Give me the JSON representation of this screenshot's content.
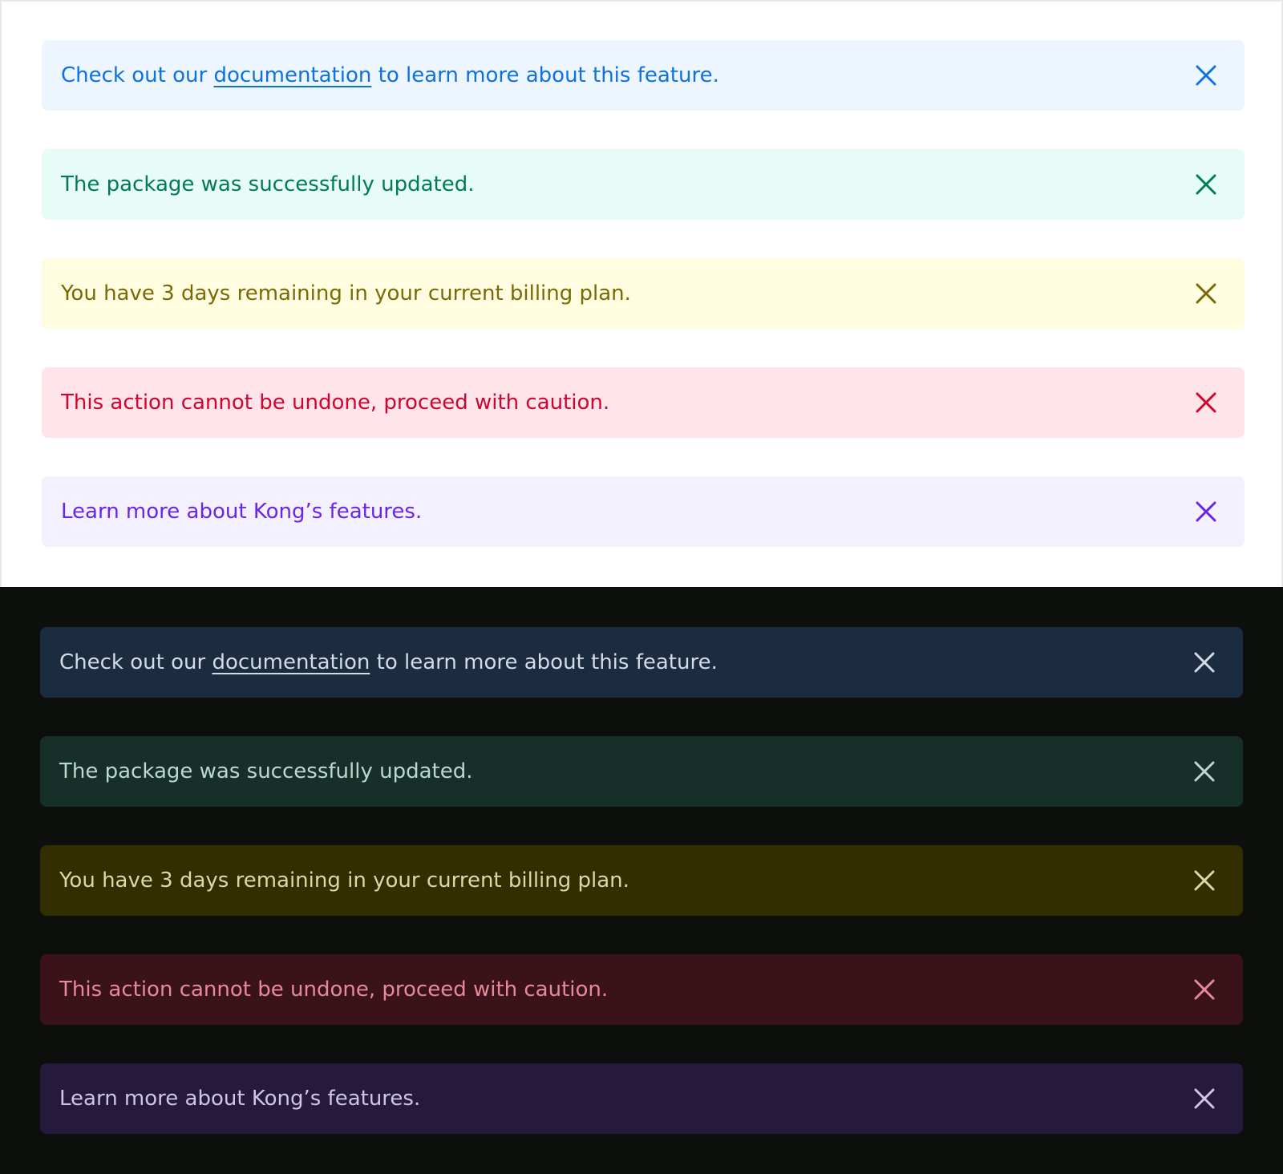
{
  "themes": {
    "light": {
      "alerts": [
        {
          "kind": "info",
          "text_before": "Check out our ",
          "link": "documentation",
          "text_after": " to learn more about this feature.",
          "bg": "#edf6ff",
          "fg": "#0f71e0",
          "icon": "close-icon"
        },
        {
          "kind": "success",
          "text": "The package was successfully updated.",
          "bg": "#e8fcf7",
          "fg": "#007a5a",
          "icon": "close-icon"
        },
        {
          "kind": "warning",
          "text": "You have 3 days remaining in your current billing plan.",
          "bg": "#fffce0",
          "fg": "#7a6a05",
          "icon": "close-icon"
        },
        {
          "kind": "danger",
          "text": "This action cannot be undone, proceed with caution.",
          "bg": "#ffe5e9",
          "fg": "#d1042f",
          "icon": "close-icon"
        },
        {
          "kind": "decorative",
          "text": "Learn more about Kong’s features.",
          "bg": "#f3f0ff",
          "fg": "#6a26e6",
          "icon": "close-icon"
        }
      ]
    },
    "dark": {
      "alerts": [
        {
          "kind": "info",
          "text_before": "Check out our ",
          "link": "documentation",
          "text_after": " to learn more about this feature.",
          "bg": "#1b2b40",
          "fg": "#d4dbe4",
          "icon": "close-icon"
        },
        {
          "kind": "success",
          "text": "The package was successfully updated.",
          "bg": "#172f29",
          "fg": "#bcd7cf",
          "icon": "close-icon"
        },
        {
          "kind": "warning",
          "text": "You have 3 days remaining in your current billing plan.",
          "bg": "#332e00",
          "fg": "#ddd6a6",
          "icon": "close-icon"
        },
        {
          "kind": "danger",
          "text": "This action cannot be undone, proceed with caution.",
          "bg": "#3a1219",
          "fg": "#e68a99",
          "icon": "close-icon"
        },
        {
          "kind": "decorative",
          "text": "Learn more about Kong’s features.",
          "bg": "#25193c",
          "fg": "#cfc4ea",
          "icon": "close-icon"
        }
      ]
    }
  }
}
